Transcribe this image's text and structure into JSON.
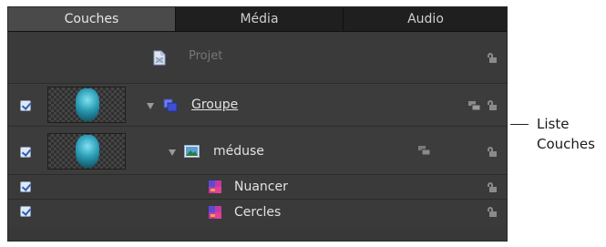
{
  "tabs": [
    {
      "label": "Couches",
      "active": true
    },
    {
      "label": "Média",
      "active": false
    },
    {
      "label": "Audio",
      "active": false
    }
  ],
  "layers": [
    {
      "name": "Projet",
      "kind": "project",
      "checked": null,
      "disclosure": null,
      "has_thumbnail": false,
      "icon": "project-document-icon"
    },
    {
      "name": "Groupe",
      "kind": "group",
      "checked": true,
      "disclosure": "expanded",
      "has_thumbnail": true,
      "icon": "group-icon"
    },
    {
      "name": "méduse",
      "kind": "image",
      "checked": true,
      "disclosure": "expanded",
      "has_thumbnail": true,
      "icon": "image-icon"
    },
    {
      "name": "Nuancer",
      "kind": "filter",
      "checked": true,
      "disclosure": null,
      "has_thumbnail": false,
      "icon": "filter-icon"
    },
    {
      "name": "Cercles",
      "kind": "filter",
      "checked": true,
      "disclosure": null,
      "has_thumbnail": false,
      "icon": "filter-icon"
    }
  ],
  "callout": {
    "line1": "Liste",
    "line2": "Couches"
  },
  "colors": {
    "panel_bg": "#383838",
    "tab_bar_bg": "#1f1f1f",
    "active_tab_bg": "#4a4a4a",
    "text": "#e2e2e2",
    "dim_text": "#777777",
    "check_mark": "#2b5fb8"
  }
}
